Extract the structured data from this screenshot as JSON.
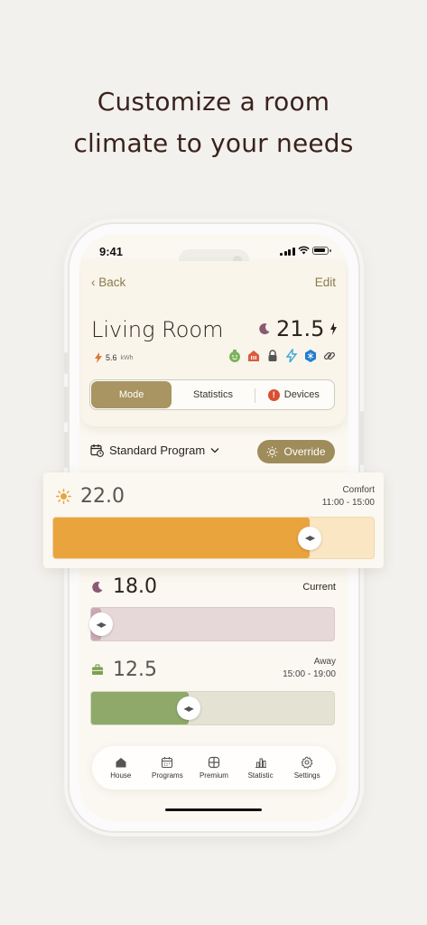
{
  "headline": {
    "line1": "Customize a room",
    "line2": "climate to your needs"
  },
  "status_bar": {
    "time": "9:41"
  },
  "nav": {
    "back_label": "Back",
    "edit_label": "Edit"
  },
  "room": {
    "name": "Living Room",
    "temperature": "21.5",
    "energy_value": "5.6",
    "energy_unit": "kWh",
    "device_icons": [
      "smiley-icon",
      "heater-icon",
      "lock-icon",
      "bolt-icon",
      "snowflake-icon",
      "link-icon"
    ]
  },
  "segment": {
    "mode_label": "Mode",
    "statistics_label": "Statistics",
    "devices_label": "Devices",
    "devices_warning": "!"
  },
  "program": {
    "label": "Standard Program",
    "override_label": "Override"
  },
  "modes": [
    {
      "name": "Comfort",
      "temperature": "22.0",
      "time": "11:00 - 15:00",
      "level_percent": 80,
      "color": "#e9a43e"
    },
    {
      "name": "Current",
      "temperature": "18.0",
      "time": "",
      "level_percent": 4,
      "color": "#c9a9b3"
    },
    {
      "name": "Away",
      "temperature": "12.5",
      "time": "15:00 - 19:00",
      "level_percent": 40,
      "color": "#8fa96a"
    }
  ],
  "tabbar": {
    "items": [
      {
        "label": "House",
        "icon": "house-icon"
      },
      {
        "label": "Programs",
        "icon": "calendar-icon"
      },
      {
        "label": "Premium",
        "icon": "premium-icon"
      },
      {
        "label": "Statistic",
        "icon": "chart-icon"
      },
      {
        "label": "Settings",
        "icon": "gear-icon"
      }
    ]
  },
  "colors": {
    "accent": "#a89562",
    "headline": "#3a231c",
    "background": "#f3f1ee"
  }
}
